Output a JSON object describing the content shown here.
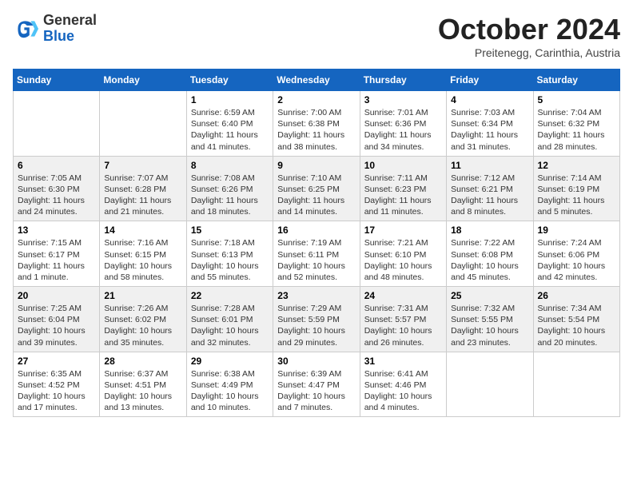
{
  "header": {
    "logo_general": "General",
    "logo_blue": "Blue",
    "month_title": "October 2024",
    "subtitle": "Preitenegg, Carinthia, Austria"
  },
  "weekdays": [
    "Sunday",
    "Monday",
    "Tuesday",
    "Wednesday",
    "Thursday",
    "Friday",
    "Saturday"
  ],
  "weeks": [
    [
      {
        "day": "",
        "info": ""
      },
      {
        "day": "",
        "info": ""
      },
      {
        "day": "1",
        "info": "Sunrise: 6:59 AM\nSunset: 6:40 PM\nDaylight: 11 hours\nand 41 minutes."
      },
      {
        "day": "2",
        "info": "Sunrise: 7:00 AM\nSunset: 6:38 PM\nDaylight: 11 hours\nand 38 minutes."
      },
      {
        "day": "3",
        "info": "Sunrise: 7:01 AM\nSunset: 6:36 PM\nDaylight: 11 hours\nand 34 minutes."
      },
      {
        "day": "4",
        "info": "Sunrise: 7:03 AM\nSunset: 6:34 PM\nDaylight: 11 hours\nand 31 minutes."
      },
      {
        "day": "5",
        "info": "Sunrise: 7:04 AM\nSunset: 6:32 PM\nDaylight: 11 hours\nand 28 minutes."
      }
    ],
    [
      {
        "day": "6",
        "info": "Sunrise: 7:05 AM\nSunset: 6:30 PM\nDaylight: 11 hours\nand 24 minutes."
      },
      {
        "day": "7",
        "info": "Sunrise: 7:07 AM\nSunset: 6:28 PM\nDaylight: 11 hours\nand 21 minutes."
      },
      {
        "day": "8",
        "info": "Sunrise: 7:08 AM\nSunset: 6:26 PM\nDaylight: 11 hours\nand 18 minutes."
      },
      {
        "day": "9",
        "info": "Sunrise: 7:10 AM\nSunset: 6:25 PM\nDaylight: 11 hours\nand 14 minutes."
      },
      {
        "day": "10",
        "info": "Sunrise: 7:11 AM\nSunset: 6:23 PM\nDaylight: 11 hours\nand 11 minutes."
      },
      {
        "day": "11",
        "info": "Sunrise: 7:12 AM\nSunset: 6:21 PM\nDaylight: 11 hours\nand 8 minutes."
      },
      {
        "day": "12",
        "info": "Sunrise: 7:14 AM\nSunset: 6:19 PM\nDaylight: 11 hours\nand 5 minutes."
      }
    ],
    [
      {
        "day": "13",
        "info": "Sunrise: 7:15 AM\nSunset: 6:17 PM\nDaylight: 11 hours\nand 1 minute."
      },
      {
        "day": "14",
        "info": "Sunrise: 7:16 AM\nSunset: 6:15 PM\nDaylight: 10 hours\nand 58 minutes."
      },
      {
        "day": "15",
        "info": "Sunrise: 7:18 AM\nSunset: 6:13 PM\nDaylight: 10 hours\nand 55 minutes."
      },
      {
        "day": "16",
        "info": "Sunrise: 7:19 AM\nSunset: 6:11 PM\nDaylight: 10 hours\nand 52 minutes."
      },
      {
        "day": "17",
        "info": "Sunrise: 7:21 AM\nSunset: 6:10 PM\nDaylight: 10 hours\nand 48 minutes."
      },
      {
        "day": "18",
        "info": "Sunrise: 7:22 AM\nSunset: 6:08 PM\nDaylight: 10 hours\nand 45 minutes."
      },
      {
        "day": "19",
        "info": "Sunrise: 7:24 AM\nSunset: 6:06 PM\nDaylight: 10 hours\nand 42 minutes."
      }
    ],
    [
      {
        "day": "20",
        "info": "Sunrise: 7:25 AM\nSunset: 6:04 PM\nDaylight: 10 hours\nand 39 minutes."
      },
      {
        "day": "21",
        "info": "Sunrise: 7:26 AM\nSunset: 6:02 PM\nDaylight: 10 hours\nand 35 minutes."
      },
      {
        "day": "22",
        "info": "Sunrise: 7:28 AM\nSunset: 6:01 PM\nDaylight: 10 hours\nand 32 minutes."
      },
      {
        "day": "23",
        "info": "Sunrise: 7:29 AM\nSunset: 5:59 PM\nDaylight: 10 hours\nand 29 minutes."
      },
      {
        "day": "24",
        "info": "Sunrise: 7:31 AM\nSunset: 5:57 PM\nDaylight: 10 hours\nand 26 minutes."
      },
      {
        "day": "25",
        "info": "Sunrise: 7:32 AM\nSunset: 5:55 PM\nDaylight: 10 hours\nand 23 minutes."
      },
      {
        "day": "26",
        "info": "Sunrise: 7:34 AM\nSunset: 5:54 PM\nDaylight: 10 hours\nand 20 minutes."
      }
    ],
    [
      {
        "day": "27",
        "info": "Sunrise: 6:35 AM\nSunset: 4:52 PM\nDaylight: 10 hours\nand 17 minutes."
      },
      {
        "day": "28",
        "info": "Sunrise: 6:37 AM\nSunset: 4:51 PM\nDaylight: 10 hours\nand 13 minutes."
      },
      {
        "day": "29",
        "info": "Sunrise: 6:38 AM\nSunset: 4:49 PM\nDaylight: 10 hours\nand 10 minutes."
      },
      {
        "day": "30",
        "info": "Sunrise: 6:39 AM\nSunset: 4:47 PM\nDaylight: 10 hours\nand 7 minutes."
      },
      {
        "day": "31",
        "info": "Sunrise: 6:41 AM\nSunset: 4:46 PM\nDaylight: 10 hours\nand 4 minutes."
      },
      {
        "day": "",
        "info": ""
      },
      {
        "day": "",
        "info": ""
      }
    ]
  ]
}
